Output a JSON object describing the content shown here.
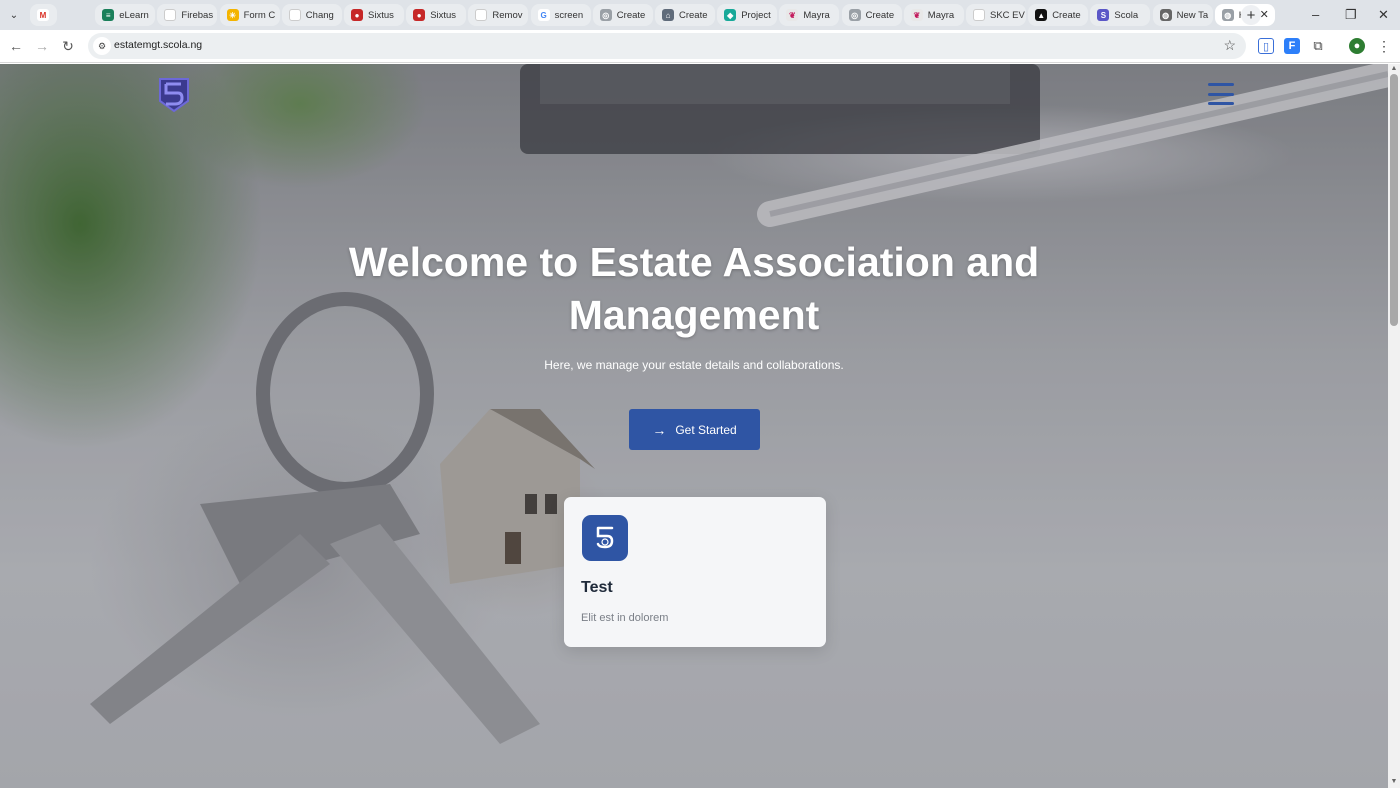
{
  "browser": {
    "tabs": [
      {
        "label": "",
        "color": "#ffffff",
        "glyph": "M",
        "glyph_color": "#d93025"
      },
      {
        "label": "eLearn",
        "color": "#1a7f5a",
        "glyph": "≡"
      },
      {
        "label": "Firebas",
        "color": "#ffffff",
        "glyph": ""
      },
      {
        "label": "Form C",
        "color": "#f4b400",
        "glyph": "✳"
      },
      {
        "label": "Chang",
        "color": "#ffffff",
        "glyph": ""
      },
      {
        "label": "Sixtus",
        "color": "#c62828",
        "glyph": "●"
      },
      {
        "label": "Sixtus",
        "color": "#c62828",
        "glyph": "●"
      },
      {
        "label": "Remov",
        "color": "#ffffff",
        "glyph": ""
      },
      {
        "label": "screen",
        "color": "#ffffff",
        "glyph": "G",
        "glyph_color": "#4285f4"
      },
      {
        "label": "Create",
        "color": "#9aa0a6",
        "glyph": "◎"
      },
      {
        "label": "Create",
        "color": "#5f6b7a",
        "glyph": "⌂"
      },
      {
        "label": "Project",
        "color": "#18a999",
        "glyph": "◆"
      },
      {
        "label": "Mayra",
        "color": "#e8e8e8",
        "glyph": "❦",
        "glyph_color": "#c2185b"
      },
      {
        "label": "Create",
        "color": "#9aa0a6",
        "glyph": "◎"
      },
      {
        "label": "Mayra",
        "color": "#e8e8e8",
        "glyph": "❦",
        "glyph_color": "#c2185b"
      },
      {
        "label": "SKC EV",
        "color": "#ffffff",
        "glyph": ""
      },
      {
        "label": "Create",
        "color": "#111111",
        "glyph": "▲"
      },
      {
        "label": "Scola",
        "color": "#5b57c7",
        "glyph": "S"
      },
      {
        "label": "New Ta",
        "color": "#666666",
        "glyph": "◍"
      },
      {
        "label": "Hc",
        "color": "#9aa0a6",
        "glyph": "◍",
        "active": true
      }
    ],
    "url": "estatemgt.scola.ng"
  },
  "header": {
    "logo_text": "5",
    "menu_icon": "hamburger-icon"
  },
  "hero": {
    "title": "Welcome to Estate Association and Management",
    "subtitle": "Here, we manage your estate details and collaborations.",
    "cta_label": "Get Started",
    "cta_icon": "arrow-right-icon"
  },
  "card": {
    "title": "Test",
    "description": "Elit est in dolorem",
    "icon": "5"
  },
  "colors": {
    "brand": "#2f55a4",
    "logo": "#5b57c7"
  }
}
